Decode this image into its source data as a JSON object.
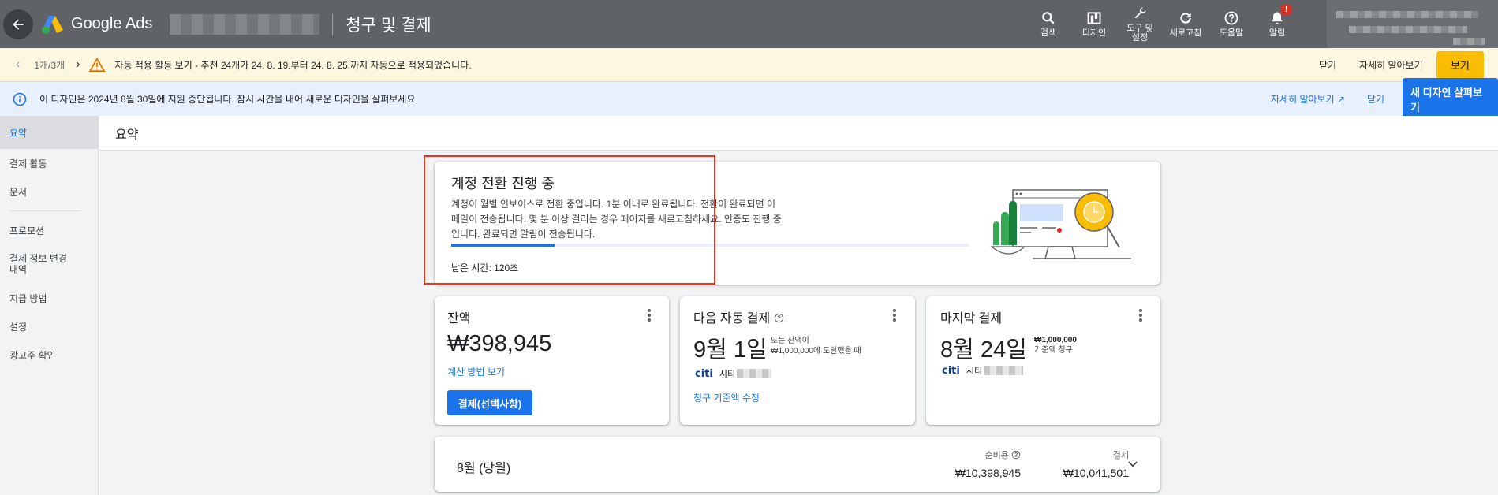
{
  "app": {
    "brand": "Google Ads",
    "page_title": "청구 및 결제",
    "brand_colors": [
      "#fbbc04",
      "#4285f4",
      "#34a853"
    ]
  },
  "toolbar": [
    {
      "label": "검색",
      "icon": "search-icon"
    },
    {
      "label": "디자인",
      "icon": "design-icon"
    },
    {
      "label": "도구 및 설정",
      "icon": "wrench-icon"
    },
    {
      "label": "새로고침",
      "icon": "refresh-icon"
    },
    {
      "label": "도움말",
      "icon": "help-icon"
    },
    {
      "label": "알림",
      "icon": "bell-icon",
      "badge": "!"
    }
  ],
  "recommend_banner": {
    "pager": "1개/3개",
    "text": "자동 적용 활동 보기 - 추천 24개가 24. 8. 19.부터 24. 8. 25.까지 자동으로 적용되었습니다.",
    "close": "닫기",
    "learn_more": "자세히 알아보기",
    "view": "보기"
  },
  "design_banner": {
    "text": "이 디자인은 2024년 8월 30일에 지원 중단됩니다. 잠시 시간을 내어 새로운 디자인을 살펴보세요",
    "learn_more": "자세히 알아보기",
    "close": "닫기",
    "new_design": "새 디자인 살펴보기"
  },
  "sidebar": {
    "items": [
      {
        "label": "요약",
        "active": true
      },
      {
        "label": "결제 활동"
      },
      {
        "label": "문서"
      },
      {
        "label": "프로모션"
      },
      {
        "label": "결제 정보 변경 내역"
      },
      {
        "label": "지급 방법"
      },
      {
        "label": "설정"
      },
      {
        "label": "광고주 확인"
      }
    ]
  },
  "main": {
    "heading": "요약"
  },
  "transition_card": {
    "title": "계정 전환 진행 중",
    "body": "계정이 월별 인보이스로 전환 중입니다. 1분 이내로 완료됩니다. 전환이 완료되면 이메일이 전송됩니다. 몇 분 이상 걸리는 경우 페이지를 새로고침하세요. 인증도 진행 중입니다. 완료되면 알림이 전송됩니다.",
    "progress": 0.2,
    "remaining": "남은 시간: 120초"
  },
  "balance_card": {
    "title": "잔액",
    "amount": "₩398,945",
    "link": "계산 방법 보기",
    "pay_button": "결제(선택사항)"
  },
  "next_payment_card": {
    "title": "다음 자동 결제",
    "date": "9월 1일",
    "note_1": "또는 잔액이",
    "note_2": "₩1,000,000에 도달했을 때",
    "bank_logo": "citi",
    "bank_name": "시티",
    "link": "청구 기준액 수정"
  },
  "last_payment_card": {
    "title": "마지막 결제",
    "date": "8월 24일",
    "amount": "₩1,000,000",
    "amount_note": "기준액 청구",
    "bank_logo": "citi",
    "bank_name": "시티"
  },
  "month_card": {
    "label": "8월 (당월)",
    "net_cost_label": "순비용",
    "net_cost": "₩10,398,945",
    "payment_label": "결제",
    "payment": "₩10,041,501"
  }
}
